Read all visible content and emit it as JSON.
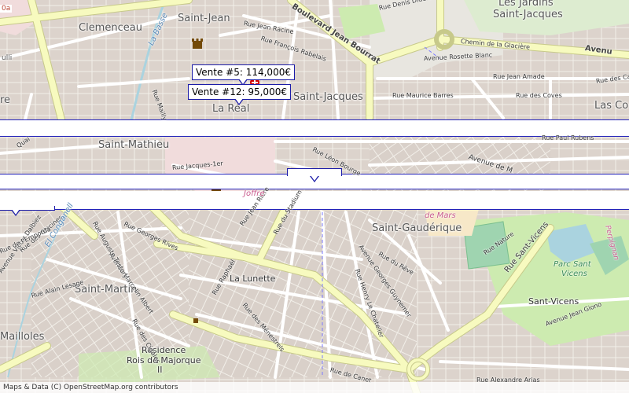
{
  "colors": {
    "land": "#f2efe9",
    "block": "#d9d0c9",
    "major_road": "#f7fabf",
    "major_road_edge": "#c7c98a",
    "road": "#ffffff",
    "park": "#cdebb0",
    "military": "#f1dcdc",
    "water": "#aad3df",
    "sport": "#9fd4b0",
    "band_border": "#2222bb",
    "popup_border": "#1c1ca8",
    "hospital": "#d40000",
    "landmark": "#734a08"
  },
  "corner_tag": "0a",
  "places": {
    "clemenceau": "Clemenceau",
    "saint_jean": "Saint-Jean",
    "la_real": "La Réal",
    "saint_jacques": "Saint-Jacques",
    "jardins_line1": "Les Jardins",
    "jardins_line2": "Saint-Jacques",
    "las_co": "Las Co",
    "saint_mathieu": "Saint-Mathieu",
    "saint_gauderique": "Saint-Gaudérique",
    "saint_martin": "Saint-Martin",
    "la_lunette": "La Lunette",
    "saint_vicens": "Sant-Vicens",
    "mailloles": "Mailloles",
    "residence_line1": "Résidence",
    "residence_line2": "Rois de Majorque",
    "residence_line3": "II",
    "ulli": "ulli",
    "re": "re"
  },
  "streets": {
    "boulevard_jean_bourrat": "Boulevard Jean Bourrat",
    "rue_racine": "Rue Jean Racine",
    "rue_rabelais": "Rue François Rabelais",
    "rue_denis_diderot": "Rue Denis Didero",
    "chemin_glaciere": "Chemin de la Glacière",
    "avenue_rosette_blanc": "Avenue Rosette Blanc",
    "avenue_top_right": "Avenu",
    "rue_jean_amade": "Rue Jean Amade",
    "rue_des_ca": "Rue des Ca",
    "rue_maurice_barres": "Rue Maurice Barres",
    "rue_des_coves": "Rue des Coves",
    "la_basse": "La Basse",
    "rue_mailly": "Rue Mailly",
    "rue_paul_rubens": "Rue Paul Rubens",
    "avenue_de_marseille": "Avenue de M",
    "rue_leon_bourgeois": "Rue Léon Bourge",
    "rue_jacques_1er": "Rue Jacques-1er",
    "rue_jean_riere": "Rue Jean Rière",
    "rue_du_stadium": "Rue du Stadium",
    "avenue_georges_guynemer": "Avenue Georges Guynemer",
    "rue_du_reve": "Rue du Rêve",
    "rue_henry_le_chatelier": "Rue Henry Le Chatelier",
    "rue_nature": "Rue Nature",
    "rue_sant_vicens": "Rue Sant-Vicens",
    "rue_des_glycines": "Rue des Glycines",
    "avenue_marcelin_albert": "Avenue Marcelin Albert",
    "rue_alain_lesage": "Rue Alain Lesage",
    "rue_raphael": "Rue Raphaël",
    "rue_des_menestrels": "Rue des Ménestrels",
    "rue_de_canet": "Rue de Canet",
    "rue_georges_rives": "Rue Georges Rives",
    "avenue_victor_dalbiez": "Avenue Victor Dalbiez",
    "rue_emporda": "Rue de l'Empordà",
    "avenue_jean_giono": "Avenue Jean Giono",
    "rue_alexandre_arias": "Rue Alexandre Arias",
    "rue_auguste_testory": "Rue Auguste Testory",
    "el_conganell": "El Conganell",
    "rue_des_cigales": "Rue des Cigales",
    "quai": "Quai"
  },
  "areas": {
    "joffre": "Joffre",
    "champ_de_mars": "de Mars",
    "parc_line1": "Parc Sant",
    "parc_line2": "Vicens",
    "perpignan": "Perpignan"
  },
  "markers": [
    {
      "id": "vente-5",
      "label": "Vente #5: 114,000€"
    },
    {
      "id": "vente-12",
      "label": "Vente #12: 95,000€"
    },
    {
      "id": "vente-hidden-1",
      "label": ""
    },
    {
      "id": "vente-hidden-2",
      "label": ""
    }
  ],
  "attribution": "Maps & Data (C) OpenStreetMap.org contributors"
}
